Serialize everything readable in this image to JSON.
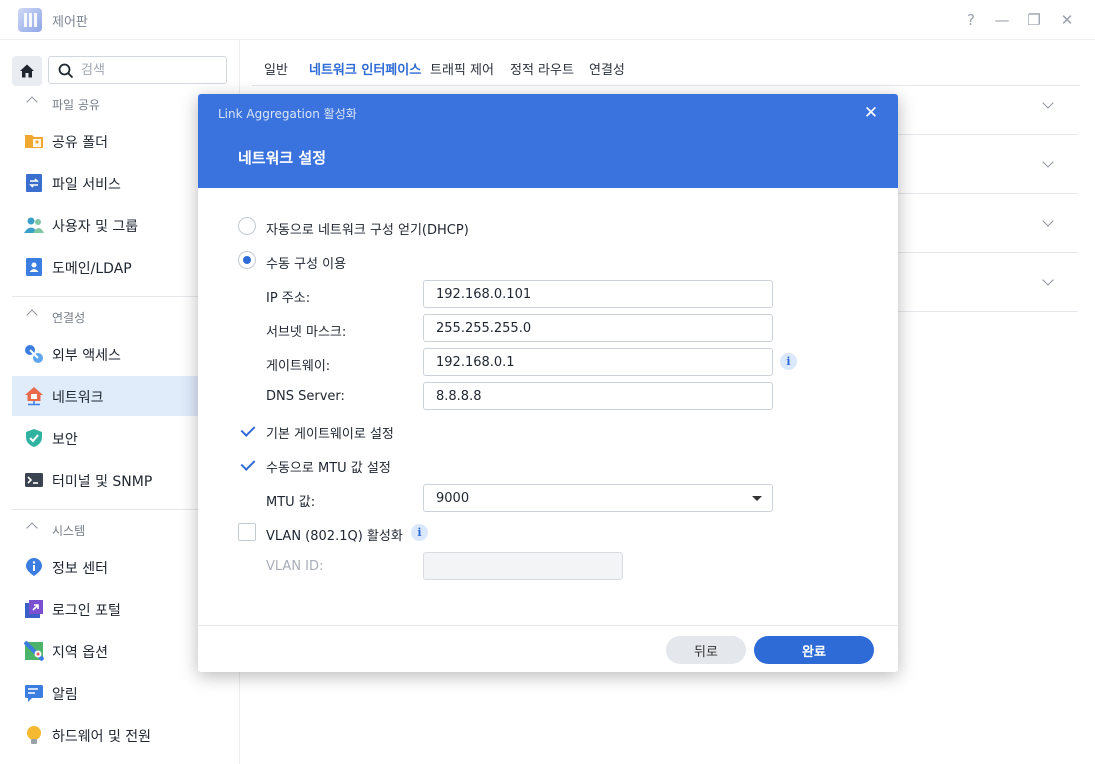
{
  "window": {
    "title": "제어판",
    "help": "?",
    "minimize": "—",
    "maximize": "❐",
    "close": "✕"
  },
  "sidebar": {
    "search_placeholder": "검색",
    "sections": [
      {
        "title": "파일 공유",
        "items": [
          {
            "label": "공유 폴더",
            "icon": "shared-folder-icon"
          },
          {
            "label": "파일 서비스",
            "icon": "file-services-icon"
          },
          {
            "label": "사용자 및 그룹",
            "icon": "user-group-icon"
          },
          {
            "label": "도메인/LDAP",
            "icon": "domain-ldap-icon"
          }
        ]
      },
      {
        "title": "연결성",
        "items": [
          {
            "label": "외부 액세스",
            "icon": "external-access-icon"
          },
          {
            "label": "네트워크",
            "icon": "network-icon",
            "active": true
          },
          {
            "label": "보안",
            "icon": "security-shield-icon"
          },
          {
            "label": "터미널 및 SNMP",
            "icon": "terminal-icon"
          }
        ]
      },
      {
        "title": "시스템",
        "items": [
          {
            "label": "정보 센터",
            "icon": "info-center-icon"
          },
          {
            "label": "로그인 포털",
            "icon": "login-portal-icon"
          },
          {
            "label": "지역 옵션",
            "icon": "regional-options-icon"
          },
          {
            "label": "알림",
            "icon": "notification-icon"
          },
          {
            "label": "하드웨어 및 전원",
            "icon": "hardware-power-icon"
          }
        ]
      }
    ]
  },
  "tabs": [
    {
      "label": "일반"
    },
    {
      "label": "네트워크 인터페이스",
      "active": true
    },
    {
      "label": "트래픽 제어"
    },
    {
      "label": "정적 라우트"
    },
    {
      "label": "연결성"
    }
  ],
  "dialog": {
    "title": "Link Aggregation 활성화",
    "subtitle": "네트워크 설정",
    "close": "✕",
    "dhcp_label": "자동으로 네트워크 구성 얻기(DHCP)",
    "manual_label": "수동 구성 이용",
    "mode": "manual",
    "fields": {
      "ip_label": "IP 주소:",
      "ip_value": "192.168.0.101",
      "subnet_label": "서브넷 마스크:",
      "subnet_value": "255.255.255.0",
      "gateway_label": "게이트웨이:",
      "gateway_value": "192.168.0.1",
      "dns_label": "DNS Server:",
      "dns_value": "8.8.8.8"
    },
    "default_gateway_label": "기본 게이트웨이로 설정",
    "default_gateway_checked": true,
    "manual_mtu_label": "수동으로 MTU 값 설정",
    "manual_mtu_checked": true,
    "mtu_label": "MTU 값:",
    "mtu_value": "9000",
    "vlan_label": "VLAN (802.1Q) 활성화",
    "vlan_checked": false,
    "vlan_id_label": "VLAN ID:",
    "vlan_id_value": "",
    "info_glyph": "i",
    "back_label": "뒤로",
    "done_label": "완료"
  },
  "colors": {
    "accent": "#2e6bd6",
    "header": "#3a73de",
    "active_nav": "#e1ecfb"
  }
}
